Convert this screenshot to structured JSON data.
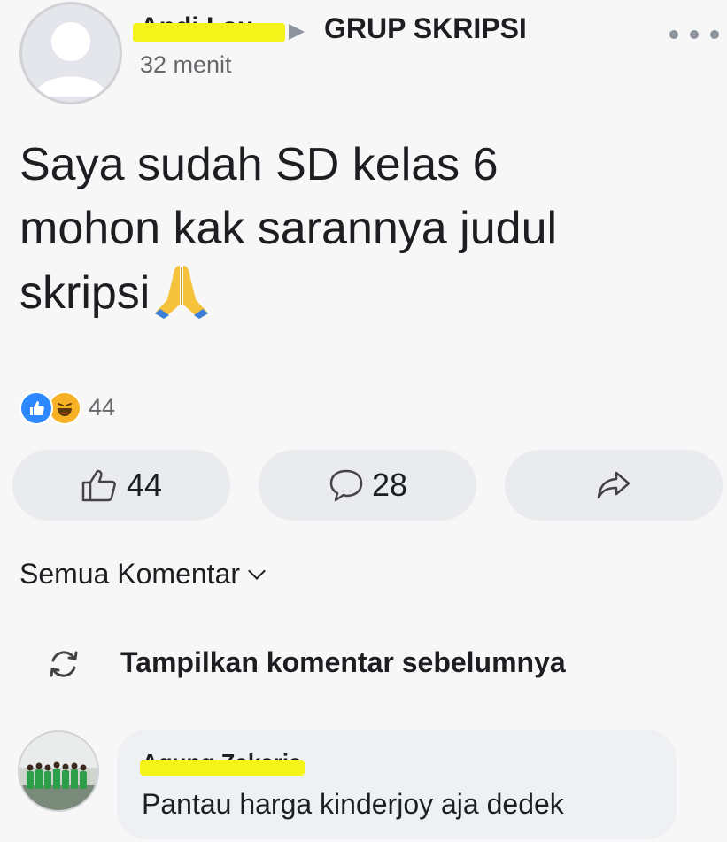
{
  "post": {
    "author": "Andi Lau",
    "group": "GRUP SKRIPSI",
    "time": "32 menit",
    "text_lines": [
      "Saya sudah SD kelas 6",
      "mohon kak sarannya judul",
      "skripsi"
    ],
    "emoji": "folded-hands"
  },
  "reactions": {
    "types": [
      "like",
      "haha"
    ],
    "count": "44"
  },
  "actions": {
    "like_count": "44",
    "comment_count": "28",
    "share_icon": "share-arrow-icon"
  },
  "comments": {
    "sort_label": "Semua Komentar",
    "show_previous": "Tampilkan komentar sebelumnya",
    "items": [
      {
        "author": "Agung Zakaria",
        "text": "Pantau harga kinderjoy aja dedek"
      }
    ]
  },
  "colors": {
    "like_blue": "#2d88ff",
    "haha_yellow": "#f7b125",
    "redaction_yellow": "#f4f31a",
    "button_bg": "#e9ebee"
  }
}
